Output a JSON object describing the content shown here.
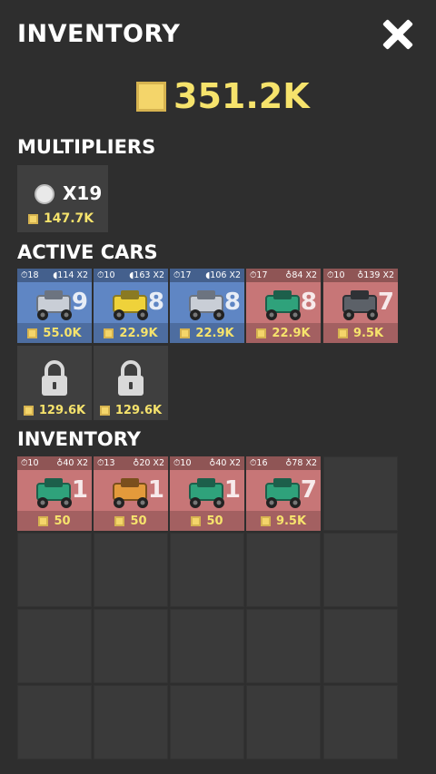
{
  "header": {
    "title": "INVENTORY"
  },
  "balance": "351.2K",
  "sections": {
    "multipliers": "MULTIPLIERS",
    "active_cars": "ACTIVE CARS",
    "inventory": "INVENTORY"
  },
  "multiplier": {
    "label": "X19",
    "price": "147.7K"
  },
  "active": [
    {
      "time": "⏱18",
      "coins": "◖114 X2",
      "level": "9",
      "price": "55.0K",
      "color": "#5f86c4",
      "car": "truck-silver"
    },
    {
      "time": "⏱10",
      "coins": "◖163 X2",
      "level": "8",
      "price": "22.9K",
      "color": "#5f86c4",
      "car": "truck-yellow"
    },
    {
      "time": "⏱17",
      "coins": "◖106 X2",
      "level": "8",
      "price": "22.9K",
      "color": "#5f86c4",
      "car": "truck-silver"
    },
    {
      "time": "⏱17",
      "coins": "♁84 X2",
      "level": "8",
      "price": "22.9K",
      "color": "#c77677",
      "car": "buggy-green"
    },
    {
      "time": "⏱10",
      "coins": "♁139 X2",
      "level": "7",
      "price": "9.5K",
      "color": "#c77677",
      "car": "monster-gray"
    }
  ],
  "locked": [
    {
      "price": "129.6K"
    },
    {
      "price": "129.6K"
    }
  ],
  "inventory": [
    {
      "time": "⏱10",
      "coins": "♁40 X2",
      "level": "1",
      "price": "50",
      "color": "#c77677",
      "car": "buggy-green"
    },
    {
      "time": "⏱13",
      "coins": "♁20 X2",
      "level": "1",
      "price": "50",
      "color": "#c77677",
      "car": "sedan-orange"
    },
    {
      "time": "⏱10",
      "coins": "♁40 X2",
      "level": "1",
      "price": "50",
      "color": "#c77677",
      "car": "buggy-green"
    },
    {
      "time": "⏱16",
      "coins": "♁78 X2",
      "level": "7",
      "price": "9.5K",
      "color": "#c77677",
      "car": "buggy-green"
    }
  ]
}
